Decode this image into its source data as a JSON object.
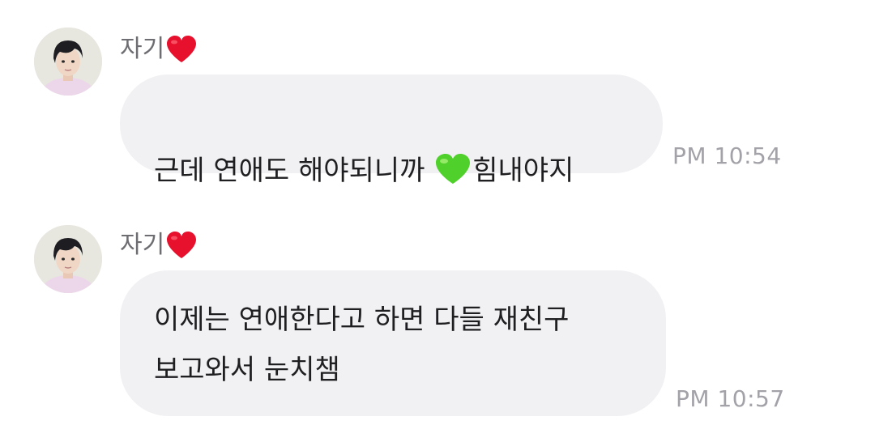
{
  "messages": [
    {
      "sender": "자기",
      "sender_icon": "red-heart-emoji",
      "text_before": "근데 연애도 해야되니까 ",
      "inline_icon": "green-heart-emoji",
      "text_after": "힘내야지",
      "time": "PM 10:54"
    },
    {
      "sender": "자기",
      "sender_icon": "red-heart-emoji",
      "text": "이제는 연애한다고 하면 다들 재친구\n보고와서 눈치챔",
      "time": "PM 10:57"
    }
  ],
  "colors": {
    "bubble": "#f1f1f4",
    "text": "#1f1f22",
    "sender": "#6d6d72",
    "time": "#a2a2a8",
    "red_heart": "#e8112d",
    "green_heart": "#4fd02b"
  }
}
